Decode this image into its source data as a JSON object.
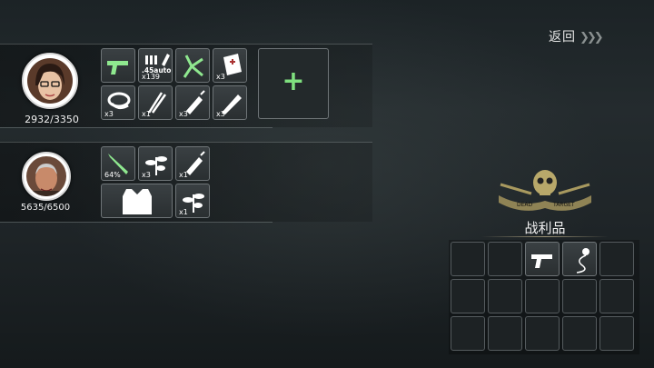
{
  "header": {
    "back_label": "返回",
    "back_chevrons": "❯❯❯"
  },
  "characters": [
    {
      "hp": "2932/3350",
      "slots": [
        {
          "icon": "pistol-icon"
        },
        {
          "icon": "ammo-icon",
          "label": ".45auto",
          "count": "x139"
        },
        {
          "icon": "slingshot-icon"
        },
        {
          "icon": "first-aid-icon",
          "count": "x3"
        },
        {
          "icon": "bandage-icon",
          "count": "x3"
        },
        {
          "icon": "sticks-icon",
          "count": "x1"
        },
        {
          "icon": "syringe-icon",
          "count": "x3"
        },
        {
          "icon": "pen-icon",
          "count": "x3"
        }
      ],
      "add_label": "+"
    },
    {
      "hp": "5635/6500",
      "slots": [
        {
          "icon": "knife-icon",
          "count": "64%"
        },
        {
          "icon": "herb-icon",
          "count": "x3"
        },
        {
          "icon": "syringe-icon",
          "count": "x1"
        },
        {
          "icon": "vest-icon"
        },
        {
          "icon": "herb-icon",
          "count": "x1"
        }
      ]
    }
  ],
  "loot": {
    "title": "战利品",
    "emblem_text": "DEAD TARGET",
    "items": [
      {
        "index": 2,
        "icon": "pistol-icon"
      },
      {
        "index": 3,
        "icon": "earphone-icon"
      }
    ]
  }
}
